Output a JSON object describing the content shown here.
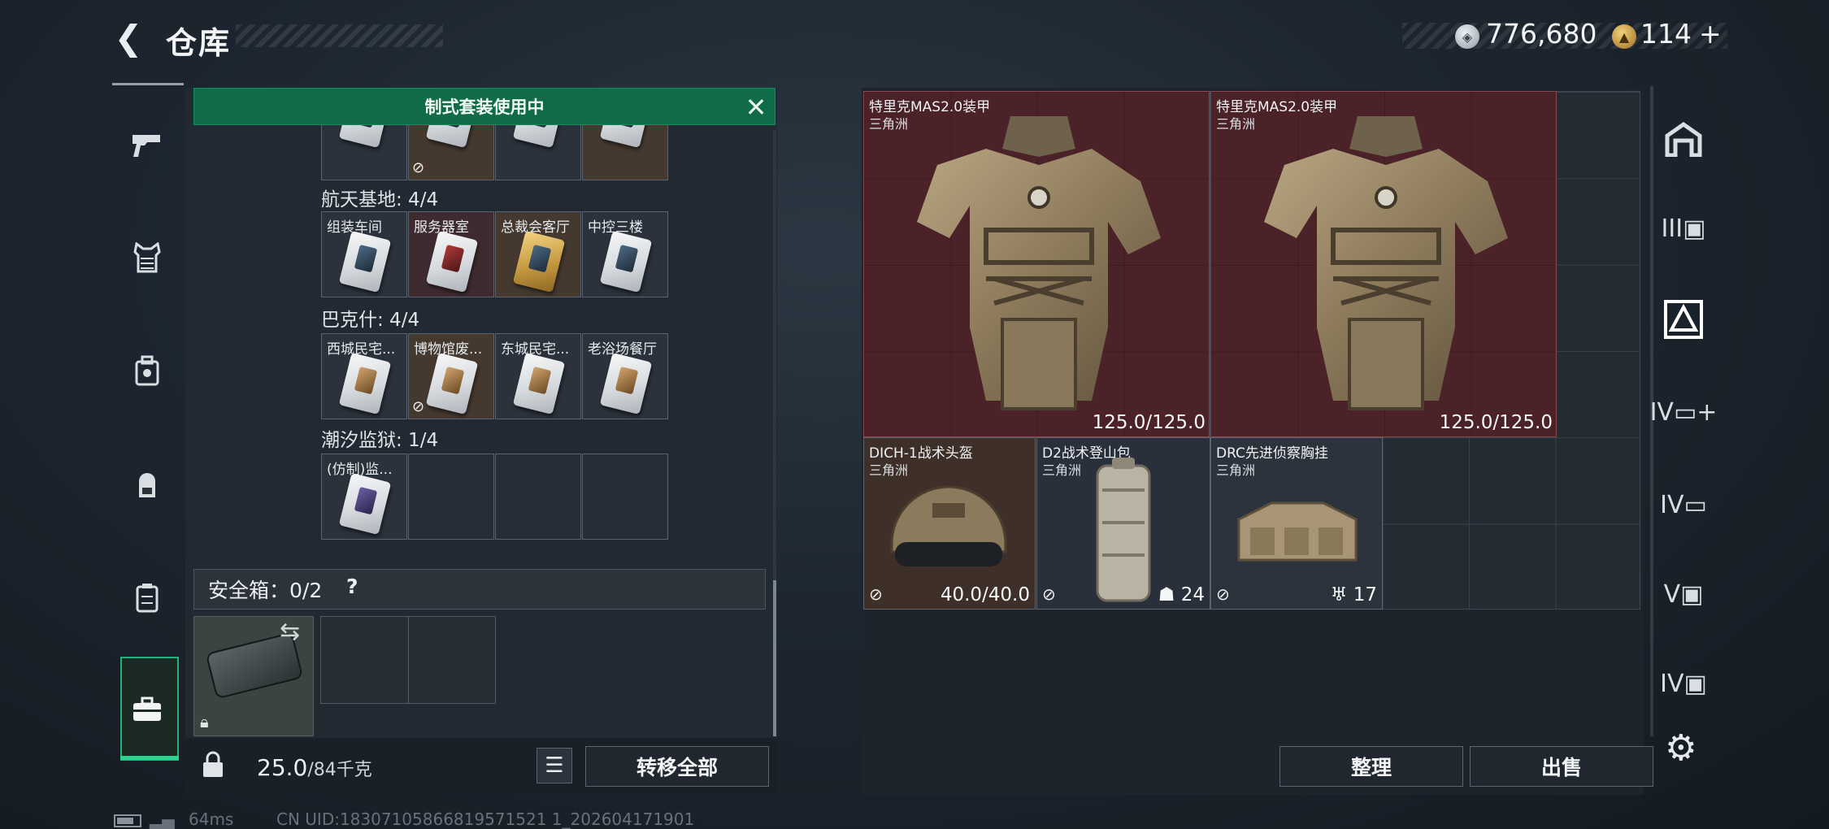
{
  "header": {
    "title": "仓库",
    "silver_amount": "776,680",
    "gold_amount": "114",
    "plus": "+"
  },
  "banner": {
    "text": "制式套装使用中"
  },
  "zones": [
    {
      "label": "航天基地: 4/4",
      "slots": [
        {
          "name": "组装车间"
        },
        {
          "name": "服务器室"
        },
        {
          "name": "总裁会客厅"
        },
        {
          "name": "中控三楼"
        }
      ]
    },
    {
      "label": "巴克什: 4/4",
      "slots": [
        {
          "name": "西城民宅..."
        },
        {
          "name": "博物馆废..."
        },
        {
          "name": "东城民宅..."
        },
        {
          "name": "老浴场餐厅"
        }
      ]
    },
    {
      "label": "潮汐监狱: 1/4",
      "slots": [
        {
          "name": "(仿制)监..."
        }
      ]
    }
  ],
  "safe_box": {
    "label": "安全箱：0/2",
    "help": "?"
  },
  "weight": {
    "current": "25.0",
    "max": "/84千克"
  },
  "buttons": {
    "transfer_all": "转移全部",
    "organize": "整理",
    "sell": "出售"
  },
  "items": [
    {
      "name": "特里克MAS2.0装甲",
      "origin": "三角洲",
      "durability": "125.0/125.0"
    },
    {
      "name": "特里克MAS2.0装甲",
      "origin": "三角洲",
      "durability": "125.0/125.0"
    },
    {
      "name": "DICH-1战术头盔",
      "origin": "三角洲",
      "durability": "40.0/40.0"
    },
    {
      "name": "D2战术登山包",
      "origin": "三角洲",
      "capacity": "24"
    },
    {
      "name": "DRC先进侦察胸挂",
      "origin": "三角洲",
      "capacity": "17"
    }
  ],
  "footer": {
    "ping": "64ms",
    "uid": "CN UID:18307105866819571521 1_202604171901"
  },
  "colors": {
    "accent_green": "#0f6b48",
    "armor_bg": "#4a2228",
    "active_nav": "#2bd38f"
  }
}
